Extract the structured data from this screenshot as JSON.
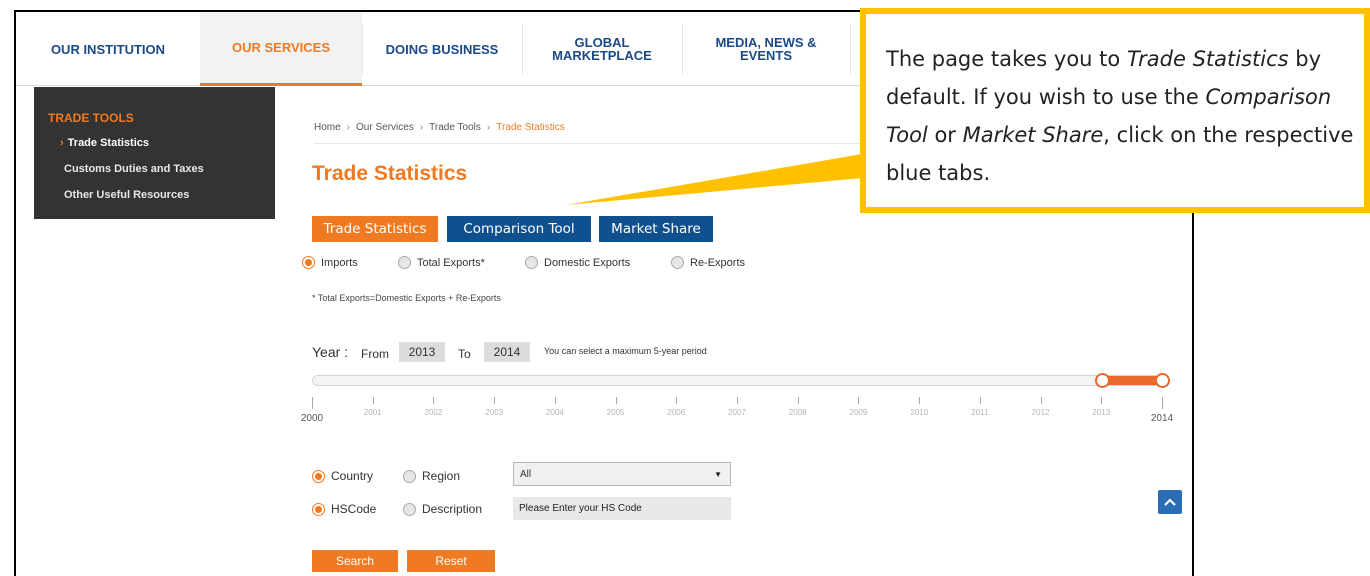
{
  "nav": {
    "items": [
      {
        "label": "OUR INSTITUTION"
      },
      {
        "label": "OUR SERVICES"
      },
      {
        "label": "DOING BUSINESS"
      },
      {
        "label": "GLOBAL\nMARKETPLACE"
      },
      {
        "label": "MEDIA, NEWS &\nEVENTS"
      }
    ]
  },
  "sidebar": {
    "heading": "TRADE TOOLS",
    "items": [
      {
        "label": "Trade Statistics",
        "marker": "›"
      },
      {
        "label": "Customs Duties and Taxes"
      },
      {
        "label": "Other Useful Resources"
      }
    ]
  },
  "breadcrumb": {
    "items": [
      "Home",
      "Our Services",
      "Trade Tools"
    ],
    "current": "Trade Statistics",
    "separator": "›"
  },
  "page_title": "Trade Statistics",
  "tabs": [
    {
      "label": "Trade Statistics"
    },
    {
      "label": "Comparison Tool"
    },
    {
      "label": "Market Share"
    }
  ],
  "flow_options": [
    {
      "label": "Imports",
      "checked": true
    },
    {
      "label": "Total Exports*",
      "checked": false
    },
    {
      "label": "Domestic Exports",
      "checked": false
    },
    {
      "label": "Re-Exports",
      "checked": false
    }
  ],
  "note": "* Total Exports=Domestic Exports + Re-Exports",
  "year": {
    "label": "Year :",
    "from_label": "From",
    "from_value": "2013",
    "to_label": "To",
    "to_value": "2014",
    "hint": "You can select a maximum 5-year period",
    "ticks": [
      "2000",
      "2001",
      "2002",
      "2003",
      "2004",
      "2005",
      "2006",
      "2007",
      "2008",
      "2009",
      "2010",
      "2011",
      "2012",
      "2013",
      "2014"
    ],
    "range_start": "2013",
    "range_end": "2014"
  },
  "filters": {
    "country_label": "Country",
    "region_label": "Region",
    "country_checked": true,
    "select_value": "All",
    "hscode_label": "HSCode",
    "description_label": "Description",
    "hscode_checked": true,
    "hs_placeholder": "Please Enter your HS Code"
  },
  "buttons": {
    "search": "Search",
    "reset": "Reset"
  },
  "callout": {
    "t1": "The page takes you to ",
    "e1": "Trade Statistics",
    "t2": " by default. If you wish to use the ",
    "e2": "Comparison Tool",
    "t3": " or ",
    "e3": "Market Share",
    "t4": ", click on the respective blue tabs."
  },
  "colors": {
    "accent": "#f07a22",
    "nav_blue": "#1a4a8a",
    "tab_blue": "#11508f",
    "callout_border": "#ffc000",
    "sidebar_bg": "#333333"
  },
  "icons": {
    "scroll_top": "chevron-up-icon",
    "select_caret": "caret-down-icon"
  }
}
